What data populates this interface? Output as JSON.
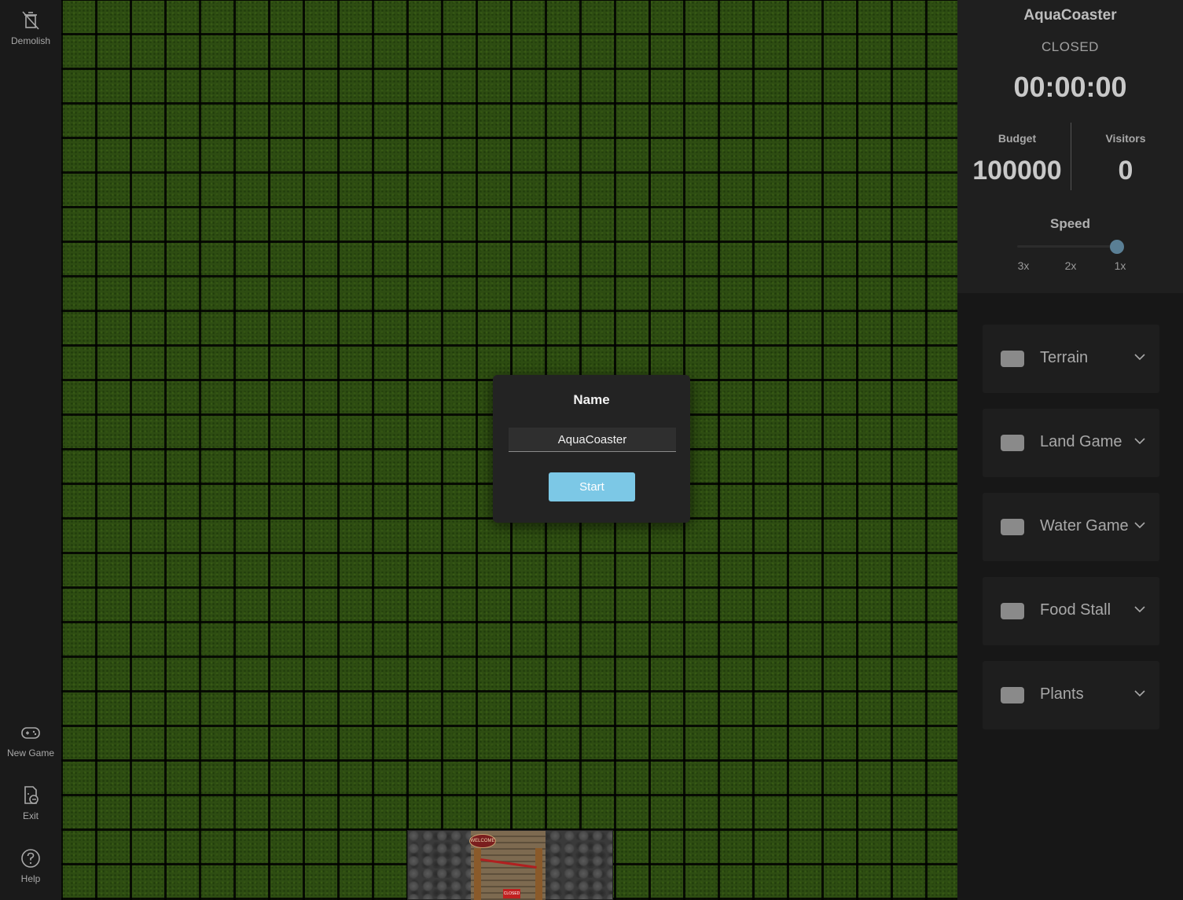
{
  "left_toolbar": {
    "demolish_label": "Demolish",
    "new_game_label": "New Game",
    "exit_label": "Exit",
    "help_label": "Help"
  },
  "map": {
    "gate_sign_welcome": "WELCOME",
    "gate_sign_closed": "CLOSED"
  },
  "modal": {
    "title": "Name",
    "name_value": "AquaCoaster",
    "start_label": "Start"
  },
  "park_info": {
    "name": "AquaCoaster",
    "status": "CLOSED",
    "time": "00:00:00",
    "budget_label": "Budget",
    "budget_value": "100000",
    "visitors_label": "Visitors",
    "visitors_value": "0",
    "speed_label": "Speed",
    "speed_options": [
      "3x",
      "2x",
      "1x"
    ],
    "speed_selected": "1x"
  },
  "categories": [
    {
      "label": "Terrain"
    },
    {
      "label": "Land Game"
    },
    {
      "label": "Water Game"
    },
    {
      "label": "Food Stall"
    },
    {
      "label": "Plants"
    }
  ],
  "colors": {
    "accent_button": "#7cc8e6",
    "slider_thumb": "#5a7f95",
    "grass": "#2e4d12"
  }
}
